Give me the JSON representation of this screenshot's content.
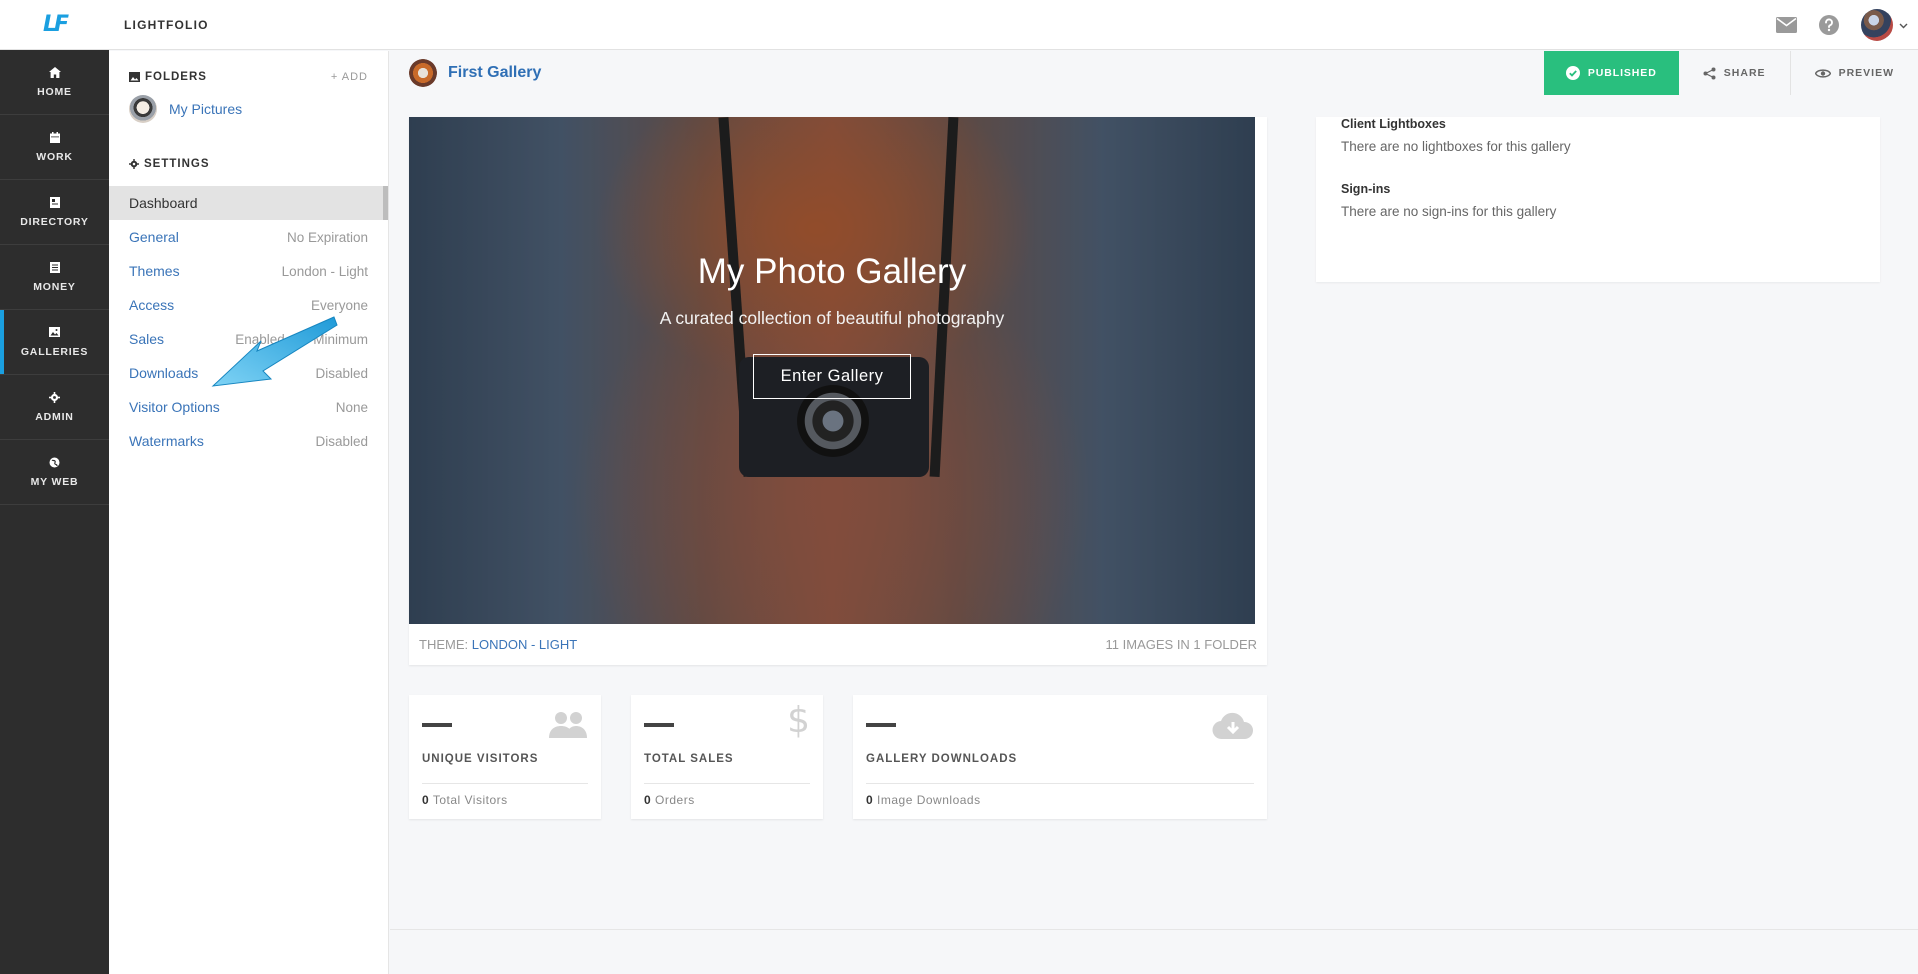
{
  "brand": {
    "logo": "LF",
    "name": "LIGHTFOLIO"
  },
  "rail": [
    {
      "label": "HOME",
      "icon": "home-icon"
    },
    {
      "label": "WORK",
      "icon": "calendar-icon"
    },
    {
      "label": "DIRECTORY",
      "icon": "directory-icon"
    },
    {
      "label": "MONEY",
      "icon": "money-icon"
    },
    {
      "label": "GALLERIES",
      "icon": "image-icon",
      "active": true
    },
    {
      "label": "ADMIN",
      "icon": "gear-icon"
    },
    {
      "label": "MY WEB",
      "icon": "globe-icon"
    }
  ],
  "folders": {
    "title": "FOLDERS",
    "add": "+ ADD",
    "items": [
      {
        "name": "My Pictures"
      }
    ]
  },
  "settings": {
    "title": "SETTINGS",
    "items": [
      {
        "name": "Dashboard",
        "value": "",
        "active": true
      },
      {
        "name": "General",
        "value": "No Expiration"
      },
      {
        "name": "Themes",
        "value": "London - Light"
      },
      {
        "name": "Access",
        "value": "Everyone"
      },
      {
        "name": "Sales",
        "value": "Enabled, No Minimum"
      },
      {
        "name": "Downloads",
        "value": "Disabled"
      },
      {
        "name": "Visitor Options",
        "value": "None"
      },
      {
        "name": "Watermarks",
        "value": "Disabled"
      }
    ]
  },
  "gallery": {
    "title": "First Gallery",
    "published": "PUBLISHED",
    "share": "SHARE",
    "preview": "PREVIEW"
  },
  "hero": {
    "title": "My Photo Gallery",
    "subtitle": "A curated collection of beautiful photography",
    "button": "Enter Gallery",
    "theme_label": "THEME:",
    "theme_value": "LONDON - LIGHT",
    "count": "11 IMAGES IN 1 FOLDER"
  },
  "stats": [
    {
      "title": "UNIQUE VISITORS",
      "count": "0",
      "unit": "Total Visitors",
      "icon": "people-icon"
    },
    {
      "title": "TOTAL SALES",
      "count": "0",
      "unit": "Orders",
      "icon": "dollar-icon"
    },
    {
      "title": "GALLERY DOWNLOADS",
      "count": "0",
      "unit": "Image Downloads",
      "icon": "cloud-download-icon"
    }
  ],
  "panel": {
    "lightboxes_title": "Client Lightboxes",
    "lightboxes_text": "There are no lightboxes for this gallery",
    "signins_title": "Sign-ins",
    "signins_text": "There are no sign-ins for this gallery"
  },
  "colors": {
    "accent": "#1a9fe0",
    "published": "#29bf7e",
    "link": "#3a74b8",
    "rail": "#2d2d2d"
  }
}
